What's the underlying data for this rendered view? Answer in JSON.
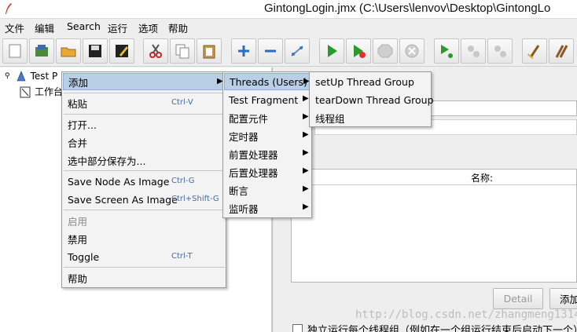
{
  "window": {
    "title": "GintongLogin.jmx (C:\\Users\\lenvov\\Desktop\\GintongLo"
  },
  "menubar": {
    "items": [
      "文件",
      "编辑",
      "Search",
      "运行",
      "选项",
      "帮助"
    ]
  },
  "toolbar": {
    "icons": [
      "new-icon",
      "templates-icon",
      "open-icon",
      "save-icon",
      "save-as-icon",
      "cut-icon",
      "copy-icon",
      "paste-icon",
      "expand-icon",
      "collapse-icon",
      "toggle-icon",
      "start-icon",
      "start-no-pause-icon",
      "stop-icon",
      "shutdown-icon",
      "remote-start-icon",
      "remote-stop-icon",
      "remote-shutdown-icon",
      "clear-icon",
      "clear-all-icon"
    ]
  },
  "tree": {
    "items": [
      {
        "label": "Test P",
        "icon": "test-plan-icon"
      },
      {
        "label": "工作台",
        "icon": "workbench-icon"
      }
    ]
  },
  "context_menu": {
    "items": [
      {
        "label": "添加",
        "shortcut": "",
        "submenu": true,
        "highlighted": true,
        "disabled": false
      },
      {
        "label": "粘贴",
        "shortcut": "Ctrl-V",
        "submenu": false,
        "highlighted": false,
        "disabled": false
      },
      {
        "label": "打开...",
        "shortcut": "",
        "submenu": false,
        "highlighted": false,
        "disabled": false
      },
      {
        "label": "合并",
        "shortcut": "",
        "submenu": false,
        "highlighted": false,
        "disabled": false
      },
      {
        "label": "选中部分保存为...",
        "shortcut": "",
        "submenu": false,
        "highlighted": false,
        "disabled": false
      },
      {
        "label": "Save Node As Image",
        "shortcut": "Ctrl-G",
        "submenu": false,
        "highlighted": false,
        "disabled": false
      },
      {
        "label": "Save Screen As Image",
        "shortcut": "Ctrl+Shift-G",
        "submenu": false,
        "highlighted": false,
        "disabled": false
      },
      {
        "label": "启用",
        "shortcut": "",
        "submenu": false,
        "highlighted": false,
        "disabled": true
      },
      {
        "label": "禁用",
        "shortcut": "",
        "submenu": false,
        "highlighted": false,
        "disabled": false
      },
      {
        "label": "Toggle",
        "shortcut": "Ctrl-T",
        "submenu": false,
        "highlighted": false,
        "disabled": false
      },
      {
        "label": "帮助",
        "shortcut": "",
        "submenu": false,
        "highlighted": false,
        "disabled": false
      }
    ]
  },
  "add_submenu": {
    "items": [
      {
        "label": "Threads (Users)",
        "highlighted": true
      },
      {
        "label": "Test Fragment",
        "highlighted": false
      },
      {
        "label": "配置元件",
        "highlighted": false
      },
      {
        "label": "定时器",
        "highlighted": false
      },
      {
        "label": "前置处理器",
        "highlighted": false
      },
      {
        "label": "后置处理器",
        "highlighted": false
      },
      {
        "label": "断言",
        "highlighted": false
      },
      {
        "label": "监听器",
        "highlighted": false
      }
    ]
  },
  "threads_submenu": {
    "items": [
      "setUp Thread Group",
      "tearDown Thread Group",
      "线程组"
    ]
  },
  "right_panel": {
    "table_header": "名称:",
    "detail_button": "Detail",
    "add_button": "添加",
    "checkbox_label": "独立运行每个线程组（例如在一个组运行结束后启动下一个）"
  },
  "watermark": "http://blog.csdn.net/zhangmeng1314",
  "colors": {
    "highlight": "#b8cfe5",
    "shortcut_text": "#4a6a9a"
  }
}
